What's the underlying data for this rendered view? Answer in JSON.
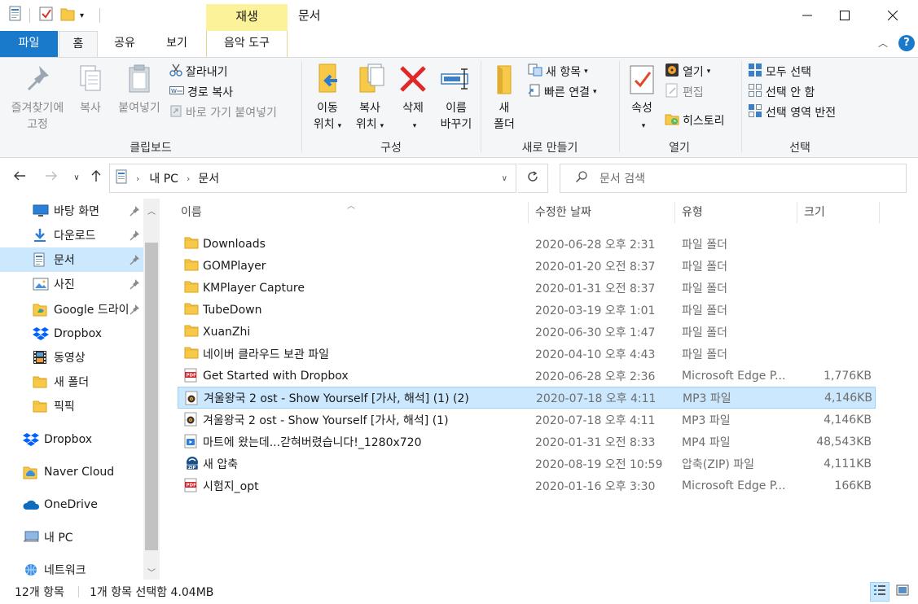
{
  "window": {
    "title": "문서",
    "context_tab": "재생"
  },
  "ribbon_tabs": {
    "file": "파일",
    "home": "홈",
    "share": "공유",
    "view": "보기",
    "music_tools": "음악 도구"
  },
  "ribbon": {
    "clipboard": {
      "label": "클립보드",
      "pin_line1": "즐겨찾기에",
      "pin_line2": "고정",
      "copy": "복사",
      "paste": "붙여넣기",
      "cut": "잘라내기",
      "copy_path": "경로 복사",
      "paste_shortcut": "바로 가기 붙여넣기"
    },
    "organize": {
      "label": "구성",
      "move_line1": "이동",
      "move_line2": "위치",
      "copyto_line1": "복사",
      "copyto_line2": "위치",
      "delete": "삭제",
      "rename_line1": "이름",
      "rename_line2": "바꾸기"
    },
    "new": {
      "label": "새로 만들기",
      "folder_line1": "새",
      "folder_line2": "폴더",
      "new_item": "새 항목",
      "easy_access": "빠른 연결"
    },
    "open": {
      "label": "열기",
      "properties": "속성",
      "open": "열기",
      "edit": "편집",
      "history": "히스토리"
    },
    "select": {
      "label": "선택",
      "select_all": "모두 선택",
      "select_none": "선택 안 함",
      "invert": "선택 영역 반전"
    }
  },
  "address": {
    "crumbs": [
      "내 PC",
      "문서"
    ],
    "search_placeholder": "문서 검색"
  },
  "nav": {
    "items": [
      {
        "label": "바탕 화면",
        "icon": "desktop-icon",
        "pinned": true
      },
      {
        "label": "다운로드",
        "icon": "download-icon",
        "pinned": true
      },
      {
        "label": "문서",
        "icon": "document-icon",
        "pinned": true
      },
      {
        "label": "사진",
        "icon": "picture-icon",
        "pinned": true
      },
      {
        "label": "Google 드라이",
        "icon": "google-drive-icon",
        "pinned": true
      },
      {
        "label": "Dropbox",
        "icon": "dropbox-icon",
        "pinned": false
      },
      {
        "label": "동영상",
        "icon": "video-icon",
        "pinned": false
      },
      {
        "label": "새 폴더",
        "icon": "folder-icon",
        "pinned": false
      },
      {
        "label": "픽픽",
        "icon": "folder-icon",
        "pinned": false
      },
      {
        "label": "Dropbox",
        "icon": "dropbox-icon",
        "pinned": false
      },
      {
        "label": "Naver Cloud",
        "icon": "naver-cloud-icon",
        "pinned": false
      },
      {
        "label": "OneDrive",
        "icon": "onedrive-icon",
        "pinned": false
      },
      {
        "label": "내 PC",
        "icon": "pc-icon",
        "pinned": false
      },
      {
        "label": "네트워크",
        "icon": "network-icon",
        "pinned": false
      }
    ]
  },
  "columns": {
    "name": "이름",
    "date": "수정한 날짜",
    "type": "유형",
    "size": "크기"
  },
  "files": [
    {
      "name": "Downloads",
      "date": "2020-06-28 오후 2:31",
      "type": "파일 폴더",
      "size": "",
      "icon": "folder-icon"
    },
    {
      "name": "GOMPlayer",
      "date": "2020-01-20 오전 8:37",
      "type": "파일 폴더",
      "size": "",
      "icon": "folder-icon"
    },
    {
      "name": "KMPlayer Capture",
      "date": "2020-01-31 오전 8:37",
      "type": "파일 폴더",
      "size": "",
      "icon": "folder-icon"
    },
    {
      "name": "TubeDown",
      "date": "2020-03-19 오후 1:01",
      "type": "파일 폴더",
      "size": "",
      "icon": "folder-icon"
    },
    {
      "name": "XuanZhi",
      "date": "2020-06-30 오후 1:47",
      "type": "파일 폴더",
      "size": "",
      "icon": "folder-icon"
    },
    {
      "name": "네이버 클라우드 보관 파일",
      "date": "2020-04-10 오후 4:43",
      "type": "파일 폴더",
      "size": "",
      "icon": "folder-icon"
    },
    {
      "name": "Get Started with Dropbox",
      "date": "2020-06-28 오후 2:36",
      "type": "Microsoft Edge P...",
      "size": "1,776KB",
      "icon": "pdf-icon"
    },
    {
      "name": "겨울왕국 2 ost - Show Yourself [가사, 해석] (1) (2)",
      "date": "2020-07-18 오후 4:11",
      "type": "MP3 파일",
      "size": "4,146KB",
      "icon": "mp3-icon"
    },
    {
      "name": "겨울왕국 2 ost - Show Yourself [가사, 해석] (1)",
      "date": "2020-07-18 오후 4:11",
      "type": "MP3 파일",
      "size": "4,146KB",
      "icon": "mp3-icon"
    },
    {
      "name": "마트에 왔는데...갇혀버렸습니다!_1280x720",
      "date": "2020-01-31 오전 8:33",
      "type": "MP4 파일",
      "size": "48,543KB",
      "icon": "mp4-icon"
    },
    {
      "name": "새 압축",
      "date": "2020-08-19 오전 10:59",
      "type": "압축(ZIP) 파일",
      "size": "4,111KB",
      "icon": "zip-icon"
    },
    {
      "name": "시험지_opt",
      "date": "2020-01-16 오후 3:30",
      "type": "Microsoft Edge P...",
      "size": "166KB",
      "icon": "pdf-icon"
    }
  ],
  "selected_file_index": 7,
  "selected_nav_index": 2,
  "status": {
    "count": "12개 항목",
    "selection": "1개 항목 선택함 4.04MB"
  },
  "colors": {
    "file_tab": "#1979ca",
    "context_tab": "#fcf29a",
    "selection": "#cce8ff",
    "folder": "#f8c948"
  }
}
